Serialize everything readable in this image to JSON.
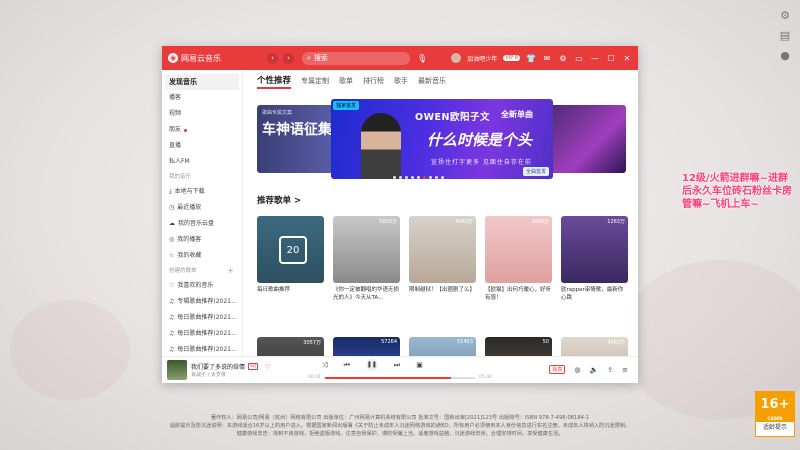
{
  "app": {
    "name": "网易云音乐",
    "search_placeholder": "搜索",
    "user_name": "加油吧少年",
    "vip_badge": "VIP 8"
  },
  "overlay_text": "12级/火箭进群嘛~进群后永久车位砖石粉丝卡房管嘛~飞机上车~",
  "sidebar": {
    "top_items": [
      "发现音乐",
      "播客",
      "视频",
      "朋友",
      "直播",
      "私人FM"
    ],
    "my_music_header": "我的音乐",
    "my_music_items": [
      "本地与下载",
      "最近播放",
      "我的音乐云盘",
      "我的播客",
      "我的收藏"
    ],
    "created_header": "创建的歌单",
    "playlists": [
      "我喜欢的音乐",
      "专辑歌曲推荐(2021...",
      "每日歌曲推荐(2021...",
      "每日歌曲推荐(2021...",
      "每日歌曲推荐(2021..."
    ]
  },
  "tabs": [
    "个性推荐",
    "专属定制",
    "歌单",
    "排行榜",
    "歌手",
    "最新音乐"
  ],
  "banner": {
    "left_small": "歌曲专属文案",
    "left_big": "车神语征集",
    "badge": "独家首发",
    "artist": "OWEN欧阳子文",
    "new_label": "全新单曲",
    "song": "什么时候是个头",
    "subtitle": "宣扬住打字更多 见面住自存在前",
    "tag": "全曲首发"
  },
  "section_title": "推荐歌单 >",
  "playlists_row1": [
    {
      "caption": "每日歌曲推荐",
      "count": "",
      "day": "20"
    },
    {
      "caption": "《你一定被翻唱的华语无损光的人》今天从TA...",
      "count": "5003万"
    },
    {
      "caption": "限制越狱！【出圈剧了么】",
      "count": "4063万"
    },
    {
      "caption": "【欧猫】出何巧暖心，好听有感！",
      "count": "3093万"
    },
    {
      "caption": "欧rapper串情歌，最新你心跳",
      "count": "1263万"
    }
  ],
  "playlists_row2": [
    {
      "count": "3057万"
    },
    {
      "count": "57264"
    },
    {
      "count": "51453"
    },
    {
      "count": "50"
    },
    {
      "count": "3463万"
    }
  ],
  "player": {
    "title": "我们要了多说的倍情",
    "quality": "SQ",
    "artist": "肖战子 / 太岁侠",
    "time_current": "00:41",
    "time_total": "05:00",
    "progress_fraction": 0.84,
    "quality_btn": "极高"
  },
  "footer_lines": [
    "著作权人：网易公司/网易（杭州）网络有限公司  出版单位：广州网易计算机系统有限公司  批准文号：国新出审[2021]123号  出版物号：ISBN 978-7-498-08184-1",
    "适龄提示及防沉迷说明：本游戏适合16岁以上的用户进入。根据国家新闻出版署《关于防止未成年人沉迷网络游戏的通知》，所有用户必须使用本人身份信息进行实名注册，未成年人将纳入防沉迷限制。",
    "健康游戏忠告：抵制不良游戏，拒绝盗版游戏。注意自我保护，谨防受骗上当。适度游戏益脑，沉迷游戏伤身。合理安排时间，享受健康生活。"
  ],
  "age_rating": {
    "number": "16+",
    "small": "CADPA",
    "label": "适龄提示"
  }
}
